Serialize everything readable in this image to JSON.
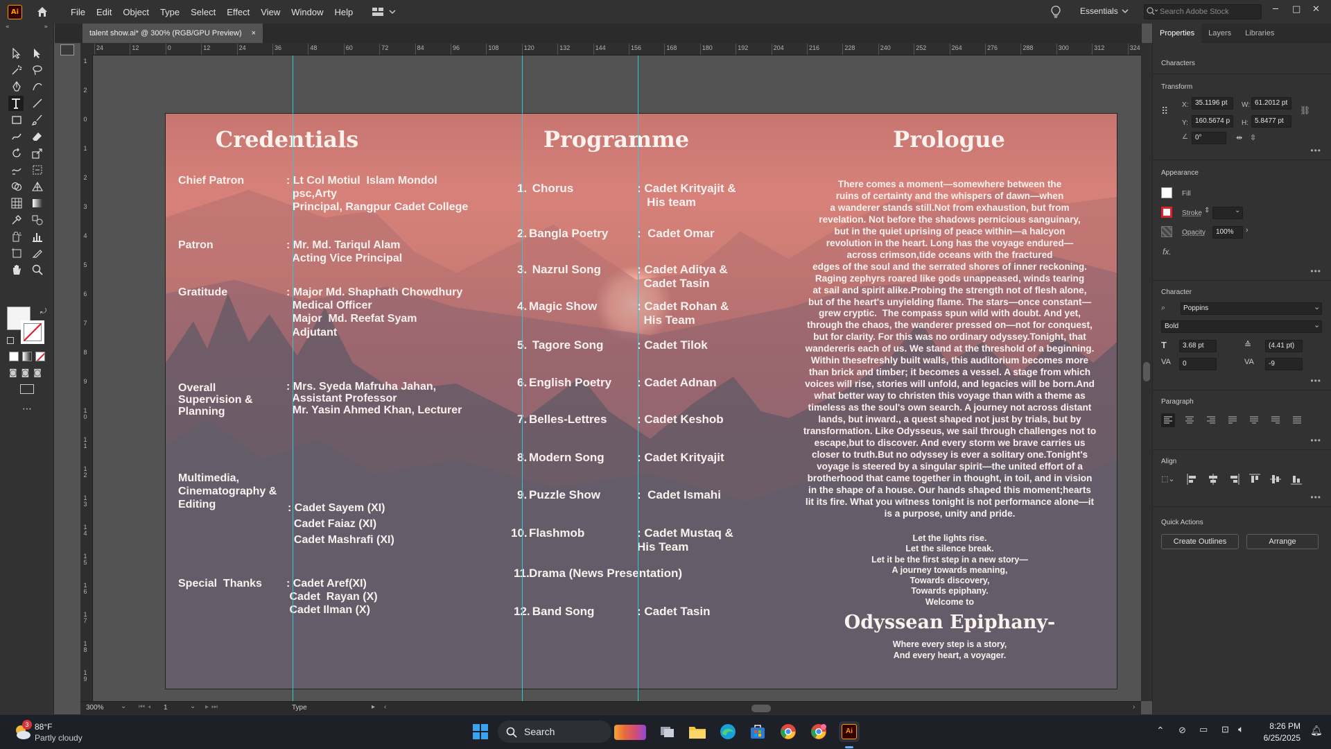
{
  "app": {
    "logo": "Ai",
    "menus": [
      "File",
      "Edit",
      "Object",
      "Type",
      "Select",
      "Effect",
      "View",
      "Window",
      "Help"
    ],
    "workspace": "Essentials",
    "stock_search_placeholder": "Search Adobe Stock"
  },
  "document": {
    "tab_title": "talent show.ai* @ 300% (RGB/GPU Preview)",
    "close": "×"
  },
  "ruler": {
    "h": [
      "24",
      "12",
      "0",
      "12",
      "24",
      "36",
      "48",
      "60",
      "72",
      "84",
      "96",
      "108",
      "120",
      "132",
      "144",
      "156",
      "168",
      "180",
      "192",
      "204",
      "216",
      "228",
      "240",
      "252",
      "264",
      "276",
      "288",
      "300",
      "312",
      "324"
    ],
    "v": [
      "1",
      "2",
      "0",
      "1",
      "2",
      "3",
      "4",
      "5",
      "6",
      "7",
      "8",
      "9",
      "1 0",
      "1 1",
      "1 2",
      "1 3",
      "1 4",
      "1 5",
      "1 6",
      "1 7",
      "1 8",
      "1 9"
    ]
  },
  "artboard": {
    "credentials": {
      "title": "Credentials",
      "rows": [
        {
          "label": "Chief Patron",
          "value": ": Lt Col Motiul  Islam Mondol\n  psc,Arty\n  Principal, Rangpur Cadet College"
        },
        {
          "label": "Patron",
          "value": ": Mr. Md. Tariqul Alam\n  Acting Vice Principal"
        },
        {
          "label": "Gratitude",
          "value": ": Major Md. Shaphath Chowdhury\n  Medical Officer\n  Major  Md. Reefat Syam\n  Adjutant"
        },
        {
          "label": "Overall\nSupervision &\nPlanning",
          "value": ": Mrs. Syeda Mafruha Jahan,\n  Assistant Professor\n  Mr. Yasin Ahmed Khan, Lecturer"
        },
        {
          "label": "Multimedia,\nCinematography &\nEditing",
          "value": ": Cadet Sayem (XI)\n  Cadet Faiaz (XI)\n  Cadet Mashrafi (XI)"
        },
        {
          "label": "Special  Thanks",
          "value": ": Cadet Aref(XI)\n Cadet  Rayan (X)\n Cadet Ilman (X)"
        }
      ]
    },
    "programme": {
      "title": "Programme",
      "items": [
        {
          "num": "1.",
          "act": " Chorus",
          "by": ": Cadet Krityajit &\n   His team"
        },
        {
          "num": "2.",
          "act": "Bangla Poetry",
          "by": ":  Cadet Omar"
        },
        {
          "num": "3.",
          "act": " Nazrul Song",
          "by": ": Cadet Aditya &\n  Cadet Tasin"
        },
        {
          "num": "4.",
          "act": "Magic Show",
          "by": ": Cadet Rohan &\n  His Team"
        },
        {
          "num": "5.",
          "act": " Tagore Song",
          "by": ": Cadet Tilok"
        },
        {
          "num": "6.",
          "act": "English Poetry",
          "by": ": Cadet Adnan"
        },
        {
          "num": "7.",
          "act": "Belles-Lettres",
          "by": ": Cadet Keshob"
        },
        {
          "num": "8.",
          "act": "Modern Song",
          "by": ": Cadet Krityajit"
        },
        {
          "num": "9.",
          "act": "Puzzle Show",
          "by": ":  Cadet Ismahi"
        },
        {
          "num": "10.",
          "act": "Flashmob",
          "by": ": Cadet Mustaq &\nHis Team"
        },
        {
          "num": "11.",
          "act": "Drama (News Presentation)",
          "by": ""
        },
        {
          "num": "12.",
          "act": " Band Song",
          "by": ": Cadet Tasin"
        }
      ]
    },
    "prologue": {
      "title": "Prologue",
      "text": "There comes a moment—somewhere between the\nruins of certainty and the whispers of dawn—when\na wanderer stands still.Not from exhaustion, but from\nrevelation. Not before the shadows pernicious sanguinary,\nbut in the quiet uprising of peace within—a halcyon\nrevolution in the heart. Long has the voyage endured—\nacross crimson,tide oceans with the fractured\nedges of the soul and the serrated shores of inner reckoning.\nRaging zephyrs roared like gods unappeased, winds tearing\nat sail and spirit alike.Probing the strength not of flesh alone,\nbut of the heart's unyielding flame. The stars—once constant—\ngrew cryptic.  The compass spun wild with doubt. And yet,\nthrough the chaos, the wanderer pressed on—not for conquest,\nbut for clarity. For this was no ordinary odyssey.Tonight, that\nwandereris each of us. We stand at the threshold of a beginning.\nWithin thesefreshly built walls, this auditorium becomes more\nthan brick and timber; it becomes a vessel. A stage from which\nvoices will rise, stories will unfold, and legacies will be born.And\nwhat better way to christen this voyage than with a theme as\ntimeless as the soul's own search. A journey not across distant\nlands, but inward., a quest shaped not just by trials, but by\ntransformation. Like Odysseus, we sail through challenges not to\nescape,but to discover. And every storm we brave carries us\ncloser to truth.But no odyssey is ever a solitary one.Tonight's\nvoyage is steered by a singular spirit—the united effort of a\nbrotherhood that came together in thought, in toil, and in vision\nin the shape of a house. Our hands shaped this moment;hearts\nlit its fire. What you witness tonight is not performance alone—it\nis a purpose, unity and pride.",
      "poem": "Let the lights rise.\nLet the silence break.\nLet it be the first step in a new story—\nA journey towards meaning,\nTowards discovery,\nTowards epiphany.\nWelcome to",
      "headline": "Odyssean Epiphany-",
      "tagline": "Where every step is a story,\nAnd every heart, a voyager."
    }
  },
  "status": {
    "zoom": "300%",
    "page": "1",
    "tool": "Type"
  },
  "panel": {
    "tabs": [
      "Properties",
      "Layers",
      "Libraries"
    ],
    "selection": "Characters",
    "transform": "Transform",
    "x_label": "X:",
    "x": "35.1196 pt",
    "y_label": "Y:",
    "y": "160.5674 p",
    "w_label": "W:",
    "w": "61.2012 pt",
    "h_label": "H:",
    "h": "5.8477 pt",
    "angle": "0°",
    "appearance": "Appearance",
    "fill": "Fill",
    "stroke": "Stroke",
    "opacity": "Opacity",
    "opacity_val": "100%",
    "fx": "fx.",
    "character": "Character",
    "font": "Poppins",
    "style": "Bold",
    "size": "3.68 pt",
    "leading": "(4.41 pt)",
    "kern": "0",
    "track": "-9",
    "paragraph": "Paragraph",
    "align": "Align",
    "quick_actions": "Quick Actions",
    "btn_outlines": "Create Outlines",
    "btn_arrange": "Arrange"
  },
  "taskbar": {
    "temp": "88°F",
    "weather": "Partly cloudy",
    "badge": "3",
    "search": "Search",
    "time": "8:26 PM",
    "date": "6/25/2025"
  }
}
